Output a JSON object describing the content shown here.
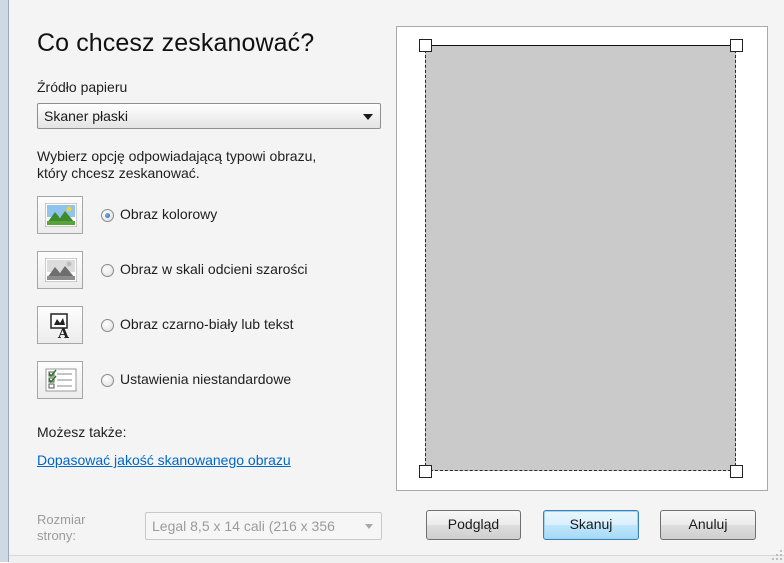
{
  "title": "Co chcesz zeskanować?",
  "paper_source": {
    "label": "Źródło papieru",
    "selected": "Skaner płaski"
  },
  "instructions": {
    "line1": "Wybierz opcję odpowiadającą typowi obrazu,",
    "line2": "który chcesz zeskanować."
  },
  "image_types": [
    {
      "label": "Obraz kolorowy",
      "selected": true,
      "icon": "color-picture-icon"
    },
    {
      "label": "Obraz w skali odcieni szarości",
      "selected": false,
      "icon": "grayscale-picture-icon"
    },
    {
      "label": "Obraz czarno-biały lub tekst",
      "selected": false,
      "icon": "black-white-text-icon"
    },
    {
      "label": "Ustawienia niestandardowe",
      "selected": false,
      "icon": "custom-settings-icon"
    }
  ],
  "also": {
    "label": "Możesz także:",
    "link": "Dopasować jakość skanowanego obrazu"
  },
  "page_size": {
    "label_line1": "Rozmiar",
    "label_line2": "strony:",
    "selected": "Legal 8,5 x 14 cali (216 x 356"
  },
  "buttons": {
    "preview": "Podgląd",
    "scan": "Skanuj",
    "cancel": "Anuluj"
  },
  "colors": {
    "link": "#0066cc",
    "preview_area": "#cacaca",
    "default_button": "#bee6fd"
  }
}
